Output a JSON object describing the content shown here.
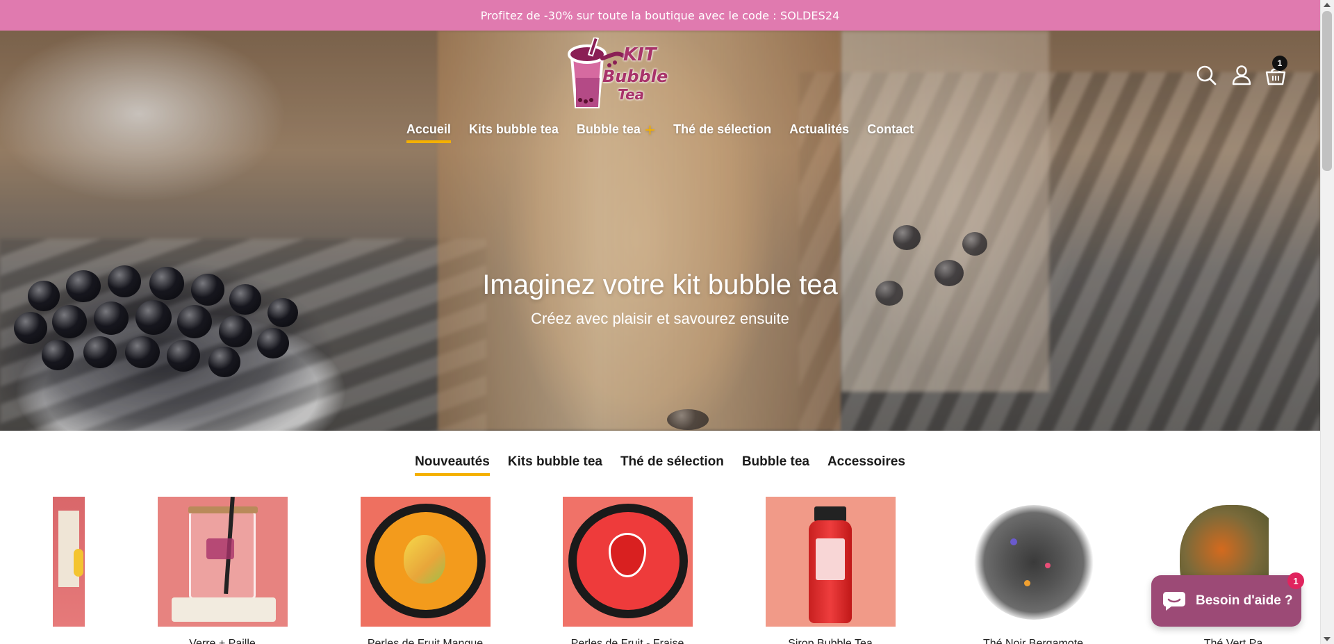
{
  "announcement": {
    "text": "Profitez de -30% sur toute la boutique avec le code : SOLDES24"
  },
  "header": {
    "logo": {
      "line1": "KIT",
      "line2": "Bubble",
      "line3": "Tea"
    },
    "icons": [
      "search-icon",
      "account-icon",
      "cart-icon"
    ],
    "cart_count": "1"
  },
  "nav": {
    "items": [
      {
        "label": "Accueil",
        "active": true
      },
      {
        "label": "Kits bubble tea"
      },
      {
        "label": "Bubble tea",
        "has_submenu": true,
        "submenu_symbol": "+"
      },
      {
        "label": "Thé de sélection"
      },
      {
        "label": "Actualités"
      },
      {
        "label": "Contact"
      }
    ]
  },
  "hero": {
    "title": "Imaginez votre kit bubble tea",
    "subtitle": "Créez avec plaisir et savourez ensuite"
  },
  "collection_tabs": [
    {
      "label": "Nouveautés",
      "active": true
    },
    {
      "label": "Kits bubble tea"
    },
    {
      "label": "Thé de sélection"
    },
    {
      "label": "Bubble tea"
    },
    {
      "label": "Accessoires"
    }
  ],
  "products": [
    {
      "title": "",
      "image": "tea-bag-partial"
    },
    {
      "title": "Verre + Paille",
      "image": "glass-cup-with-straw"
    },
    {
      "title": "Perles de Fruit Mangue",
      "image": "mango-pearls-jar"
    },
    {
      "title": "Perles de Fruit - Fraise",
      "image": "strawberry-pearls-jar"
    },
    {
      "title": "Sirop Bubble Tea",
      "image": "syrup-bottle"
    },
    {
      "title": "Thé Noir Bergamote",
      "image": "black-tea-leaves"
    },
    {
      "title": "Thé Vert Pa",
      "image": "green-tea-fruit-blend"
    }
  ],
  "chat": {
    "label": "Besoin d'aide ?",
    "badge": "1"
  },
  "colors": {
    "announcement_bg": "#e07aaf",
    "accent": "#f4b000",
    "chat_bg": "#9c4a76",
    "logo_pink": "#a8336a"
  }
}
